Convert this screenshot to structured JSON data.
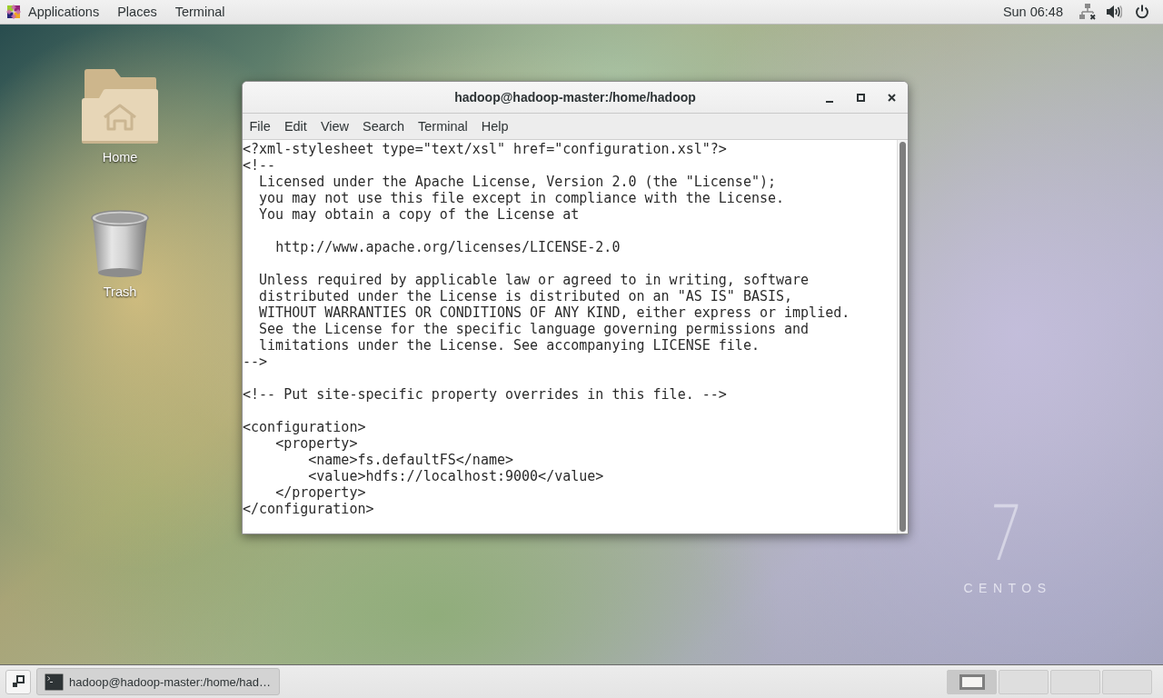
{
  "top_bar": {
    "apps_menu": {
      "label": "Applications"
    },
    "menus": [
      "Places",
      "Terminal"
    ],
    "clock": "Sun 06:48"
  },
  "desktop": {
    "icons": [
      {
        "label": "Home",
        "kind": "home-folder"
      },
      {
        "label": "Trash",
        "kind": "trash"
      }
    ],
    "logo": {
      "numeral": "7",
      "wordmark": "CENTOS"
    }
  },
  "terminal_window": {
    "title": "hadoop@hadoop-master:/home/hadoop",
    "menus": [
      "File",
      "Edit",
      "View",
      "Search",
      "Terminal",
      "Help"
    ],
    "blocks": [
      [
        "<?xml-stylesheet type=\"text/xsl\" href=\"configuration.xsl\"?>",
        "<!--",
        "  Licensed under the Apache License, Version 2.0 (the \"License\");",
        "  you may not use this file except in compliance with the License.",
        "  You may obtain a copy of the License at"
      ],
      [
        "    http://www.apache.org/licenses/LICENSE-2.0"
      ],
      [
        "  Unless required by applicable law or agreed to in writing, software",
        "  distributed under the License is distributed on an \"AS IS\" BASIS,",
        "  WITHOUT WARRANTIES OR CONDITIONS OF ANY KIND, either express or implied.",
        "  See the License for the specific language governing permissions and",
        "  limitations under the License. See accompanying LICENSE file.",
        "-->"
      ],
      [
        "<!-- Put site-specific property overrides in this file. -->"
      ],
      [
        "<configuration>",
        "    <property>",
        "        <name>fs.defaultFS</name>",
        "        <value>hdfs://localhost:9000</value>",
        "    </property>",
        "</configuration>"
      ]
    ]
  },
  "bottom_panel": {
    "tasks": [
      {
        "label": "hadoop@hadoop-master:/home/had…",
        "selected": true
      }
    ],
    "workspaces": [
      {
        "selected": true,
        "has_window": true
      },
      {
        "selected": false,
        "has_window": false
      },
      {
        "selected": false,
        "has_window": false
      },
      {
        "selected": false,
        "has_window": false
      }
    ]
  }
}
